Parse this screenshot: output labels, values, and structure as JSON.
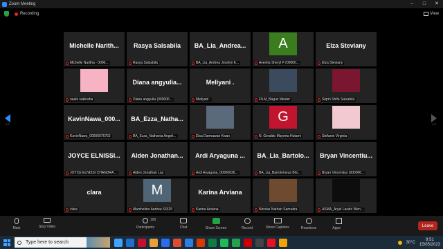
{
  "window": {
    "title": "Zoom Meeting"
  },
  "topbar": {
    "recording_label": "Recording",
    "view_label": "View"
  },
  "nav": {
    "left_page": "1/3",
    "right_page": "1/3"
  },
  "tiles": [
    {
      "big": "Michelle Narith...",
      "tag": "Michelle Naritha - 0000..."
    },
    {
      "big": "Rasya Salsabila",
      "tag": "Rasya Salsabila"
    },
    {
      "big": "BA_Lia_Andrea...",
      "tag": "BA_Lia_Andrea Jocelyn K..."
    },
    {
      "big": "",
      "avatar": "A",
      "avatar_color": "#3a7d1f",
      "tag": "Avenita Sheryl P (00000..."
    },
    {
      "big": "Elza Steviany",
      "tag": "Elza Steviany"
    },
    {
      "big": "",
      "photo": "pink",
      "tag": "naals sakinaha"
    },
    {
      "big": "Diana angyulia...",
      "tag": "Diana angyulia (000006..."
    },
    {
      "big": "Meliyani .",
      "tag": "Meliyani ."
    },
    {
      "big": "",
      "photo": "dim",
      "tag": "FILM_Bagus Mester"
    },
    {
      "big": "",
      "photo": "heart",
      "tag": "Siqrin Shifa Salsabila"
    },
    {
      "big": "KavinNawa_000...",
      "tag": "KavinNawa_00000076752"
    },
    {
      "big": "BA_Ezza_Natha...",
      "tag": "BA_Ezza_Nathania Angeli..."
    },
    {
      "big": "",
      "photo": "city",
      "tag": "Elsa Darmawan Kwan"
    },
    {
      "big": "",
      "avatar": "G",
      "avatar_color": "#c0142f",
      "tag": "N. Geraldo Mayerta Hutami"
    },
    {
      "big": "",
      "photo": "pinkwall",
      "tag": "Stefanie Virginia"
    },
    {
      "big": "JOYCE ELNISSI...",
      "tag": "JOYCE ELNISSI CHANDRA..."
    },
    {
      "big": "Alden Jonathan...",
      "tag": "Alden Jonathan Lay"
    },
    {
      "big": "Ardi Aryaguna ...",
      "tag": "Ardi Aryaguna_00000036..."
    },
    {
      "big": "BA_Lia_Bartolo...",
      "tag": "BA_Lia_Bartolomeus Bhi..."
    },
    {
      "big": "Bryan Vincentiu...",
      "tag": "Bryan Vincentius (000000..."
    },
    {
      "big": "clara",
      "tag": "clara"
    },
    {
      "big": "",
      "avatar": "M",
      "avatar_color": "#4f6475",
      "tag": "Marshelino Andrea 53325"
    },
    {
      "big": "Karina Arviana",
      "tag": "Karina Arviana"
    },
    {
      "big": "",
      "photo": "face",
      "tag": "Nicolas Nathan Samudra"
    },
    {
      "big": "",
      "photo": "dark",
      "tag": "ASMA_Aryel Laszlo Wen..."
    }
  ],
  "toolbar": {
    "mute": "Mute",
    "stop_video": "Stop Video",
    "participants": "Participants",
    "participants_count": "100",
    "chat": "Chat",
    "share_screen": "Share Screen",
    "record": "Record",
    "show_captions": "Show Captions",
    "reactions": "Reactions",
    "apps": "Apps",
    "leave": "Leave"
  },
  "taskbar": {
    "search_placeholder": "Type here to search",
    "apps_colors": [
      "#3da4ff",
      "#1f6fd1",
      "#c8102e",
      "#e8a13a",
      "#2a6ef0",
      "#e04a2d",
      "#2f7de1",
      "#d83b01",
      "#0f7b3e",
      "#1db954",
      "#22a34a",
      "#cc0000",
      "#444444",
      "#e81123",
      "#f0a30a"
    ],
    "weather": "30°C",
    "time": "9:51",
    "date": "15/05/2023"
  },
  "colors": {
    "accent": "#2d8cff",
    "leave": "#b3261e",
    "share": "#25a244"
  }
}
